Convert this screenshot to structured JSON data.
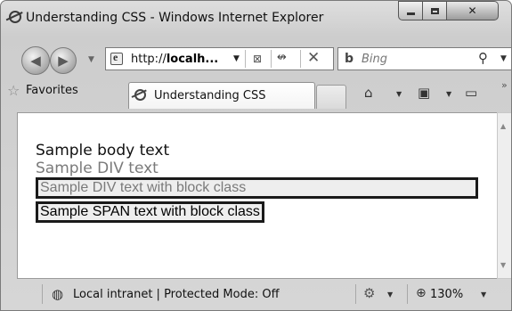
{
  "window": {
    "title": "Understanding CSS - Windows Internet Explorer"
  },
  "nav": {
    "address_url_prefix": "http://",
    "address_url_host": "localh...",
    "search_placeholder": "Bing"
  },
  "favorites": {
    "label": "Favorites"
  },
  "tab": {
    "label": "Understanding CSS"
  },
  "page": {
    "body_text": "Sample body text",
    "div_text": "Sample DIV text",
    "div_block_text": "Sample DIV text with block class",
    "span_block_text": "Sample SPAN text with block class"
  },
  "status": {
    "zone_text": "Local intranet | Protected Mode: Off",
    "zoom": "130%"
  },
  "icons": [
    "ie-icon",
    "minimize-icon",
    "maximize-icon",
    "close-icon",
    "back-icon",
    "forward-icon",
    "page-icon",
    "compatibility-icon",
    "refresh-icon",
    "stop-icon",
    "bing-icon",
    "search-icon",
    "star-icon",
    "home-icon",
    "feeds-icon",
    "print-icon",
    "globe-icon",
    "security-icon",
    "zoom-icon"
  ]
}
